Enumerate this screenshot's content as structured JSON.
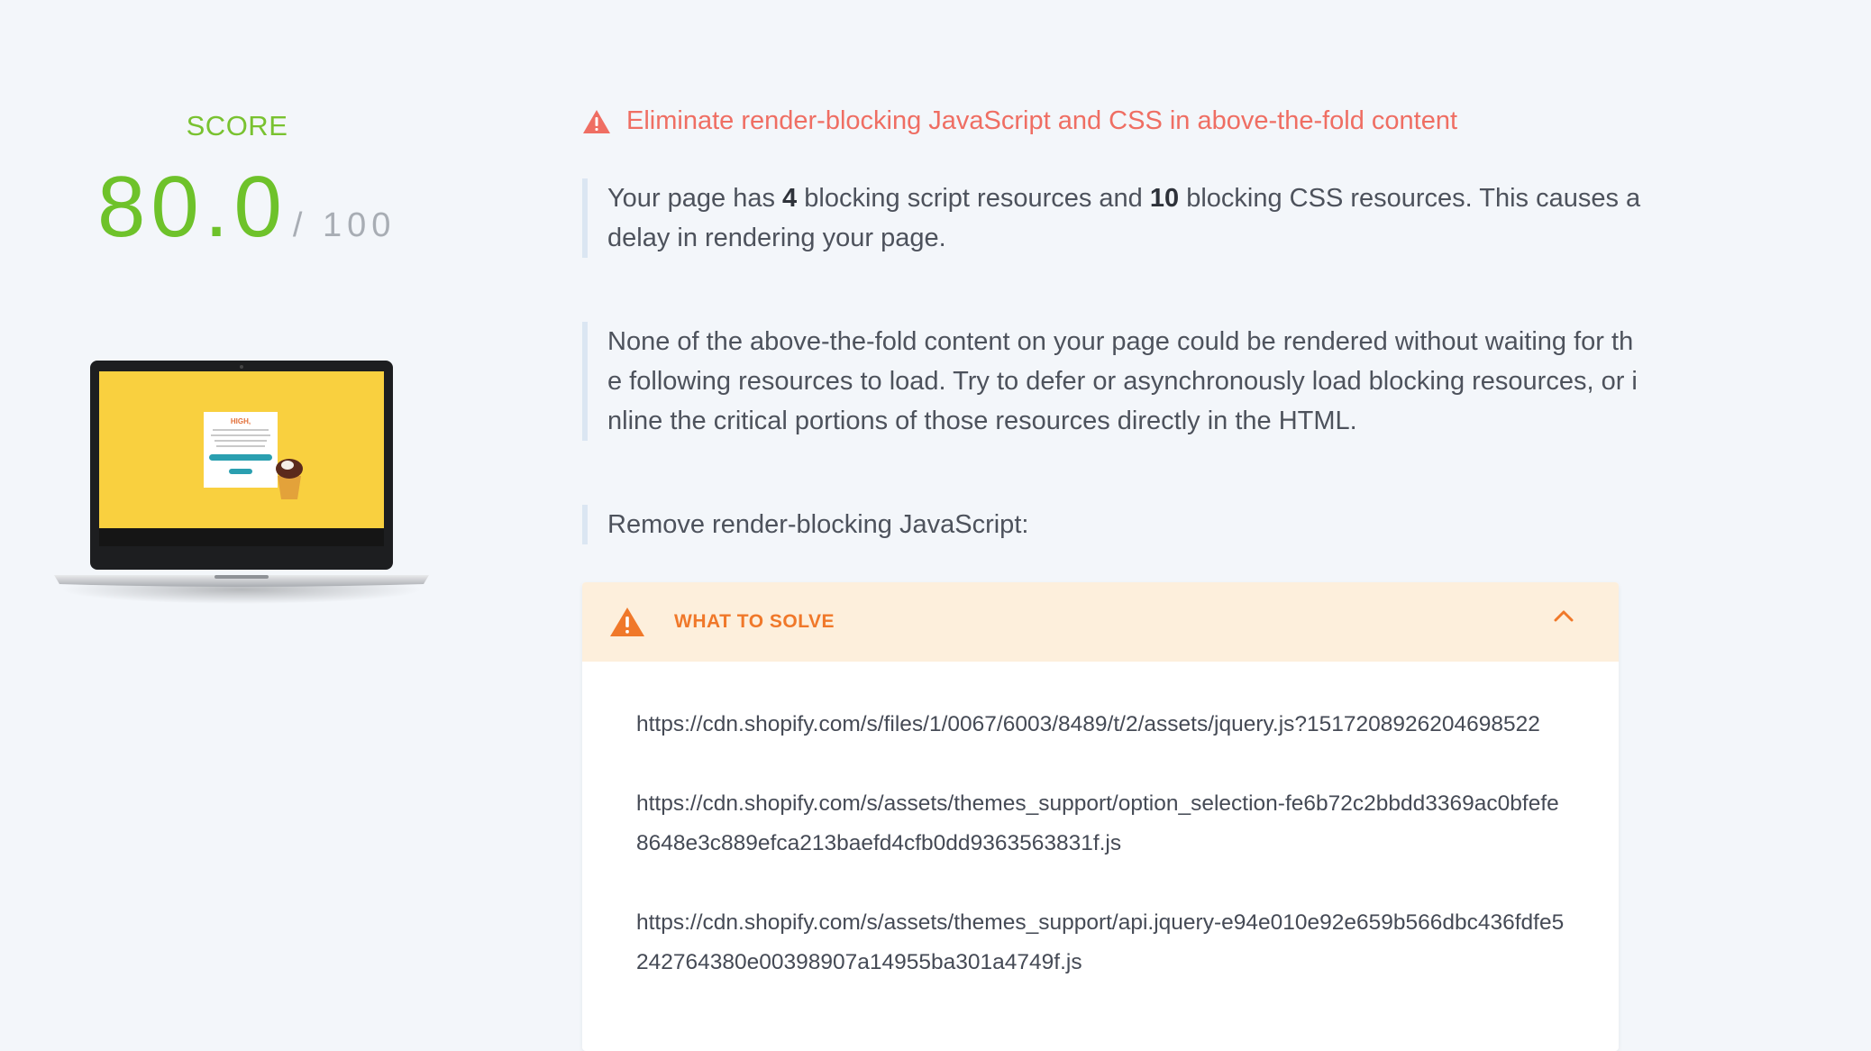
{
  "score": {
    "label": "SCORE",
    "value": "80.0",
    "max_text": "/ 100"
  },
  "issue": {
    "title": "Eliminate render-blocking JavaScript and CSS in above-the-fold content",
    "summary": {
      "pre": "Your page has ",
      "script_count": "4",
      "mid": " blocking script resources and ",
      "css_count": "10",
      "post": " blocking CSS resources. This causes a delay in rendering your page."
    },
    "detail": "None of the above-the-fold content on your page could be rendered without waiting for the following resources to load. Try to defer or asynchronously load blocking resources, or inline the critical portions of those resources directly in the HTML.",
    "section_label": "Remove render-blocking JavaScript:"
  },
  "solve": {
    "title": "WHAT TO SOLVE",
    "resources": [
      "https://cdn.shopify.com/s/files/1/0067/6003/8489/t/2/assets/jquery.js?1517208926204698522",
      "https://cdn.shopify.com/s/assets/themes_support/option_selection-fe6b72c2bbdd3369ac0bfefe8648e3c889efca213baefd4cfb0dd9363563831f.js",
      "https://cdn.shopify.com/s/assets/themes_support/api.jquery-e94e010e92e659b566dbc436fdfe5242764380e00398907a14955ba301a4749f.js"
    ]
  },
  "preview": {
    "popup_heading": "HIGH,"
  },
  "colors": {
    "score_green": "#6ec22a",
    "issue_red": "#ef6e63",
    "warning_orange": "#f0782a",
    "solve_header_bg": "#fdefdc",
    "page_bg": "#f3f6fa"
  },
  "icons": {
    "title_icon": "warning-triangle-icon",
    "solve_icon": "warning-triangle-icon",
    "toggle_icon": "chevron-up-icon"
  }
}
